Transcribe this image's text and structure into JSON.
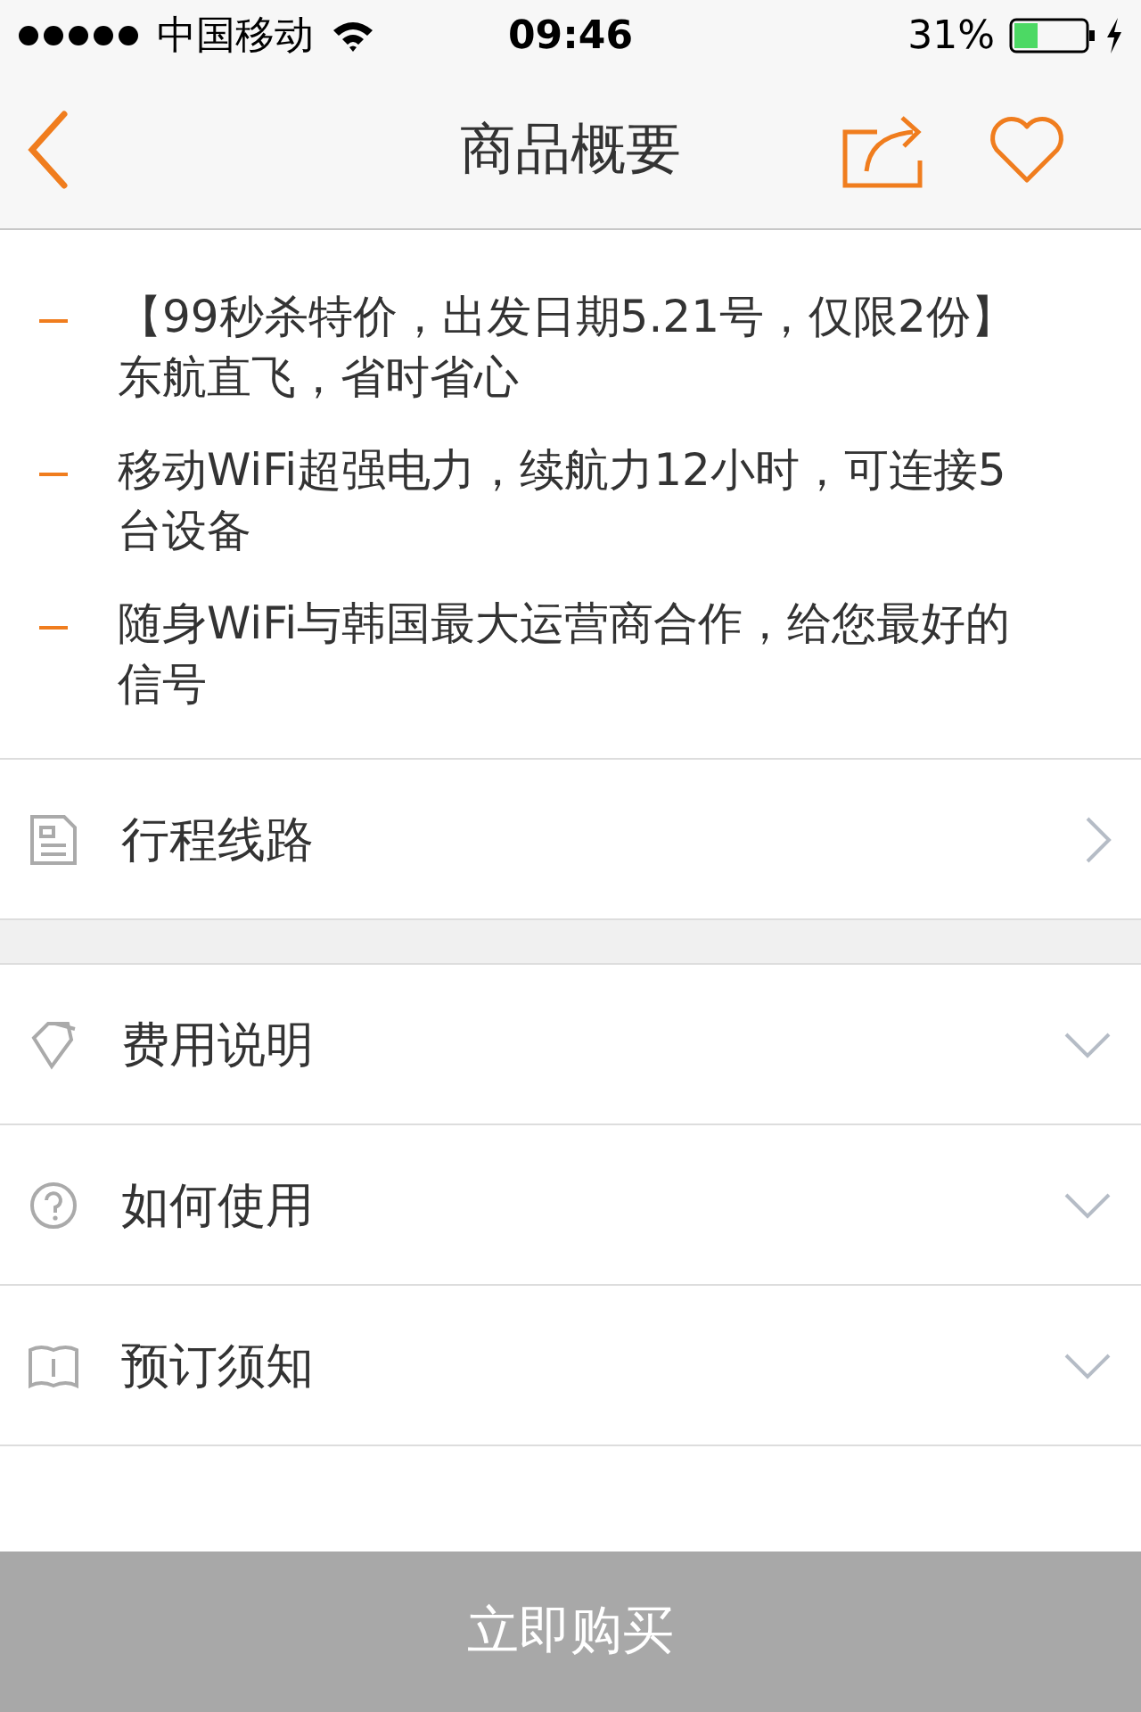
{
  "status_bar": {
    "carrier": "中国移动",
    "time": "09:46",
    "battery": "31%"
  },
  "nav": {
    "title": "商品概要"
  },
  "highlights": [
    "【99秒杀特价，出发日期5.21号，仅限2份】东航直飞，省时省心",
    "移动WiFi超强电力，续航力12小时，可连接5台设备",
    "随身WiFi与韩国最大运营商合作，给您最好的信号"
  ],
  "route": {
    "label": "行程线路"
  },
  "sections": [
    {
      "label": "费用说明",
      "expanded": false
    },
    {
      "label": "如何使用",
      "expanded": false
    },
    {
      "label": "预订须知",
      "expanded": false
    }
  ],
  "buy_button": "立即购买"
}
